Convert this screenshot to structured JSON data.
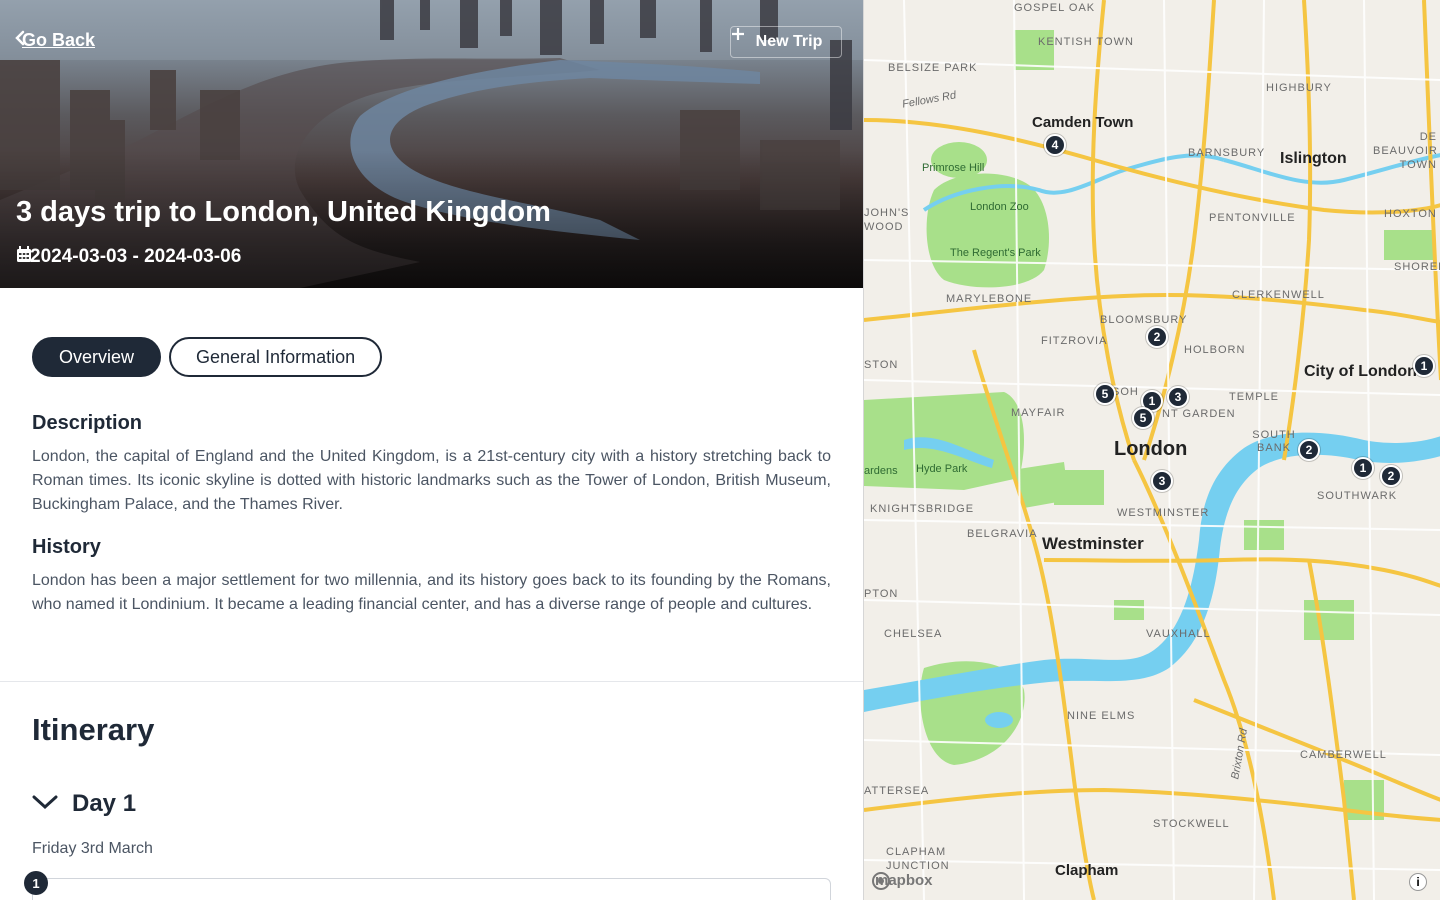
{
  "header": {
    "go_back_label": "Go Back",
    "new_trip_label": "New Trip",
    "title": "3 days trip to London, United Kingdom",
    "date_range": "2024-03-03 - 2024-03-06"
  },
  "tabs": [
    {
      "label": "Overview",
      "active": true
    },
    {
      "label": "General Information",
      "active": false
    }
  ],
  "overview": {
    "description_heading": "Description",
    "description_text": "London, the capital of England and the United Kingdom, is a 21st-century city with a history stretching back to Roman times. Its iconic skyline is dotted with historic landmarks such as the Tower of London, British Museum, Buckingham Palace, and the Thames River.",
    "history_heading": "History",
    "history_text": "London has been a major settlement for two millennia, and its history goes back to its founding by the Romans, who named it Londinium. It became a leading financial center, and has a diverse range of people and cultures."
  },
  "itinerary": {
    "heading": "Itinerary",
    "days": [
      {
        "label": "Day 1",
        "date": "Friday 3rd March",
        "first_step": "1"
      }
    ]
  },
  "map": {
    "places": {
      "gospel_oak": "GOSPEL OAK",
      "kentish_town": "KENTISH TOWN",
      "belsize_park": "BELSIZE PARK",
      "highbury": "HIGHBURY",
      "de_beauvoir": "DE BEAUVOIR TOWN",
      "barnsbury": "BARNSBURY",
      "pentonville": "PENTONVILLE",
      "hoxton": "HOXTON",
      "shoreditch": "SHORED",
      "johns_wood": "JOHN'S WOOD",
      "marylebone": "MARYLEBONE",
      "clerkenwell": "CLERKENWELL",
      "bloomsbury": "BLOOMSBURY",
      "holborn": "HOLBORN",
      "fitzrovia": "FITZROVIA",
      "euston": "STON",
      "mayfair": "MAYFAIR",
      "soho": "SOH",
      "covent_garden": "NT GARDEN",
      "temple": "TEMPLE",
      "south_bank": "SOUTH BANK",
      "southwark": "SOUTHWARK",
      "knightsbridge": "KNIGHTSBRIDGE",
      "belgravia": "BELGRAVIA",
      "westminster_district": "WESTMINSTER",
      "pimlico": "PTON",
      "chelsea": "CHELSEA",
      "vauxhall": "VAUXHALL",
      "nine_elms": "NINE ELMS",
      "battersea": "ATTERSEA",
      "camberwell": "CAMBERWELL",
      "stockwell": "STOCKWELL",
      "clapham_junction": "CLAPHAM JUNCTION",
      "fellows_rd": "Fellows Rd",
      "brixton_rd": "Brixton Rd"
    },
    "cities": {
      "camden": "Camden Town",
      "islington": "Islington",
      "city_of_london": "City of London",
      "london": "London",
      "westminster": "Westminster",
      "clapham": "Clapham"
    },
    "parks": {
      "primrose": "Primrose Hill",
      "zoo": "London Zoo",
      "regents": "The Regent's Park",
      "hyde": "Hyde Park",
      "gardens": "ardens"
    },
    "markers": [
      "4",
      "2",
      "5",
      "1",
      "3",
      "5",
      "3",
      "2",
      "1",
      "2",
      "1"
    ],
    "attribution": "mapbox",
    "info_label": "i",
    "colors": {
      "road_major": "#f5c542",
      "water": "#75cff0",
      "park": "#a8e08a",
      "land": "#f2efe9",
      "marker": "#1f2937"
    }
  }
}
